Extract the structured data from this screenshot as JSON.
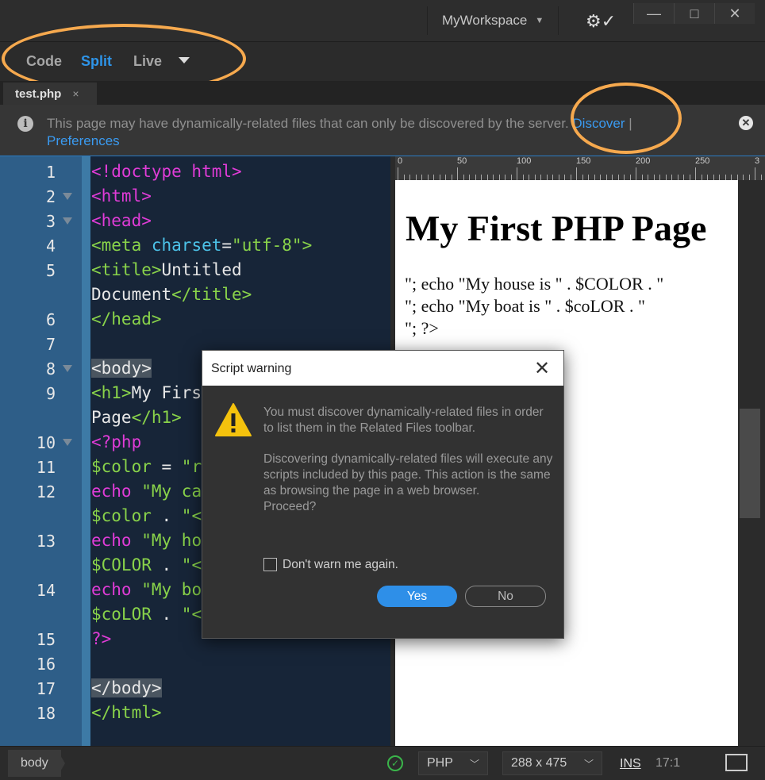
{
  "titlebar": {
    "workspace": "MyWorkspace",
    "window_controls": [
      "minimize",
      "maximize",
      "close"
    ]
  },
  "view_modes": {
    "code": "Code",
    "split": "Split",
    "live": "Live",
    "active": "Split"
  },
  "tab": {
    "label": "test.php",
    "close": "×"
  },
  "infobar": {
    "message": "This page may have dynamically-related files that can only be discovered by the server.",
    "discover": "Discover",
    "separator": "|",
    "preferences": "Preferences"
  },
  "code": {
    "line_numbers": [
      "1",
      "2",
      "3",
      "4",
      "5",
      "",
      "6",
      "7",
      "8",
      "9",
      "",
      "10",
      "11",
      "12",
      "",
      "13",
      "",
      "14",
      "",
      "15",
      "16",
      "17",
      "18"
    ]
  },
  "ruler": {
    "labels": [
      "0",
      "50",
      "100",
      "150",
      "200",
      "250",
      "3"
    ]
  },
  "live": {
    "heading": "My First PHP Page",
    "lines": [
      "\"; echo \"My house is \" . $COLOR . \"",
      "\"; echo \"My boat is \" . $coLOR . \"",
      "\"; ?>"
    ]
  },
  "dialog": {
    "title": "Script warning",
    "message1": "You must discover dynamically-related files in order to list them in the Related Files toolbar.",
    "message2": "Discovering dynamically-related files will execute any scripts included by this page.  This action is the same as browsing the page in a web browser.",
    "message3": "Proceed?",
    "checkbox_label": "Don't warn me again.",
    "checkbox_checked": false,
    "yes": "Yes",
    "no": "No"
  },
  "statusbar": {
    "breadcrumb": "body",
    "language": "PHP",
    "window_size": "288 x 475",
    "mode": "INS",
    "cursor": "17:1"
  },
  "colors": {
    "accent": "#2e8fe8",
    "highlight_ring": "#f6a94e",
    "tag": "#e03cd7",
    "string": "#89d34a",
    "attr": "#4cc2e8"
  }
}
